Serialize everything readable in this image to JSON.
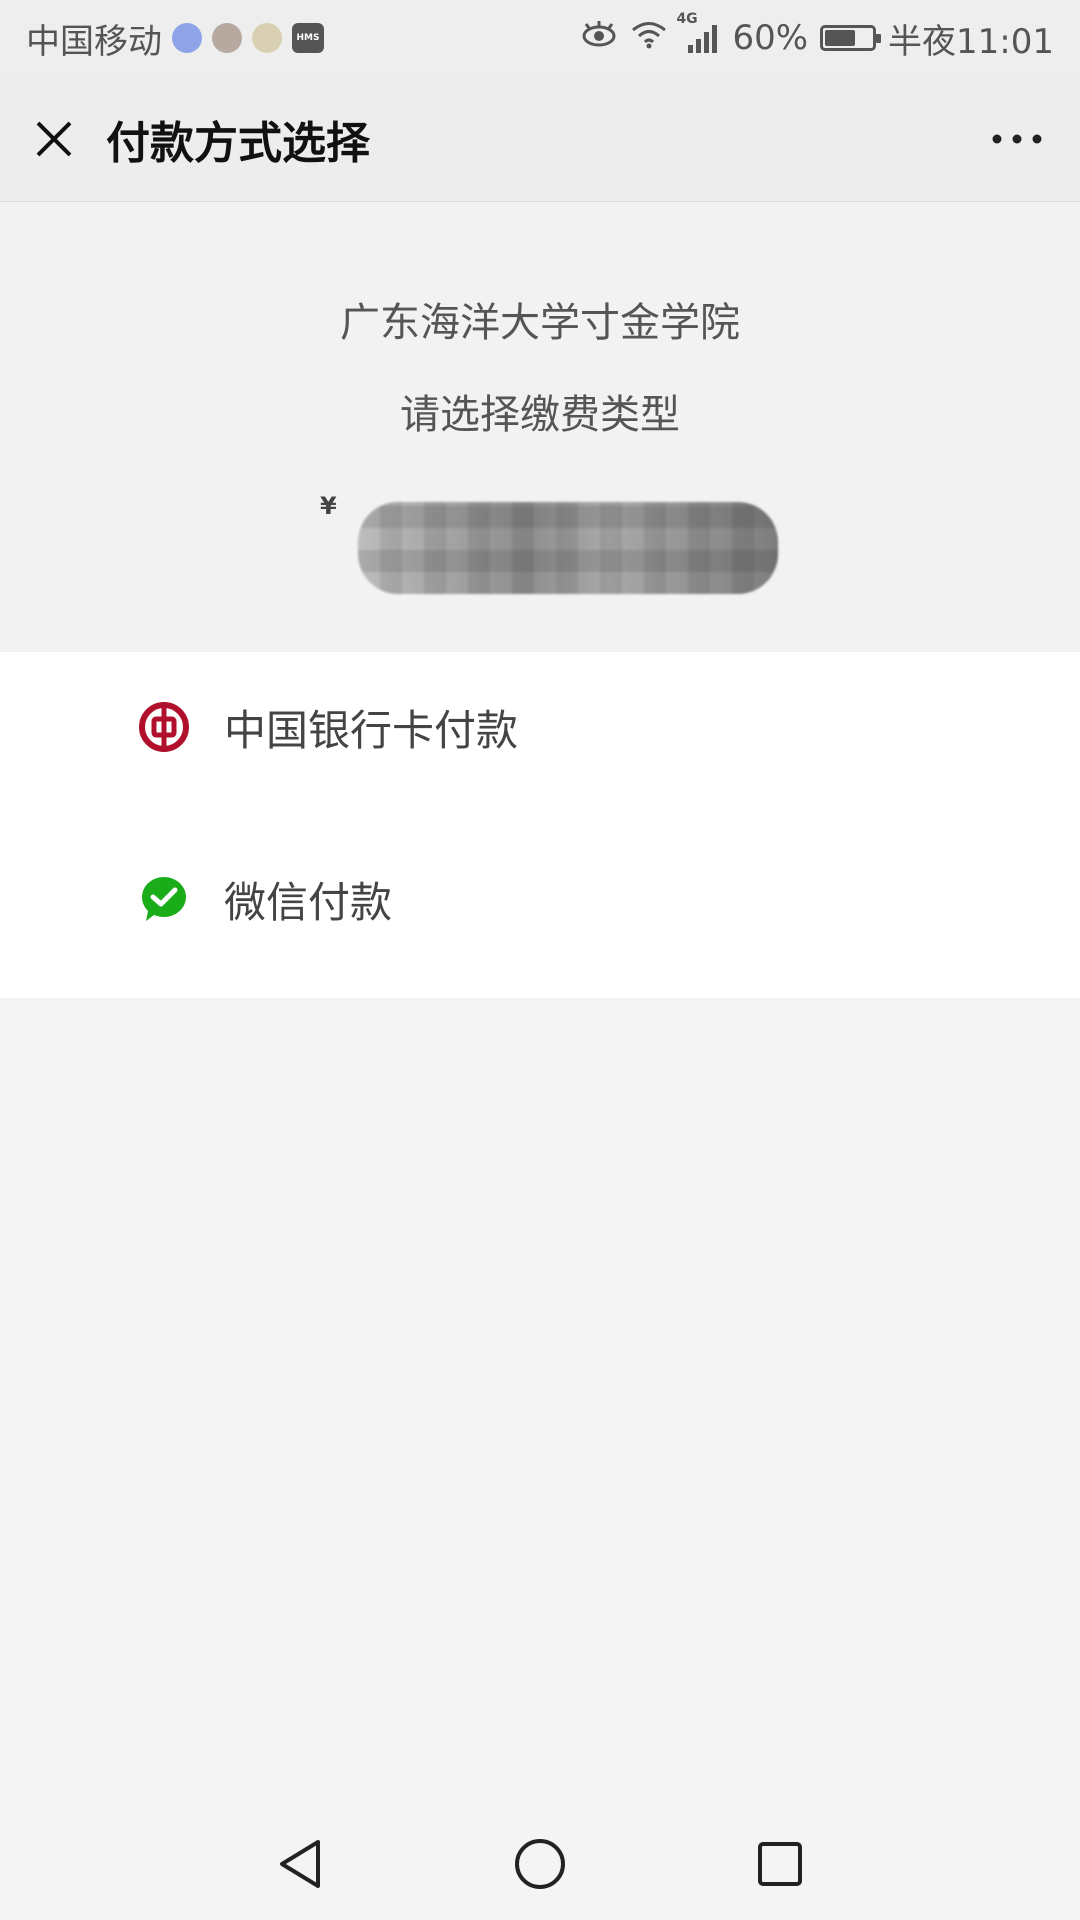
{
  "status_bar": {
    "carrier": "中国移动",
    "network": "4G",
    "battery": "60%",
    "time": "半夜11:01",
    "hms_label": "HMS"
  },
  "title_bar": {
    "title": "付款方式选择"
  },
  "header": {
    "school_name": "广东海洋大学寸金学院",
    "prompt": "请选择缴费类型",
    "currency_symbol": "¥"
  },
  "payment_options": [
    {
      "label": "中国银行卡付款",
      "icon": "bank-of-china-icon",
      "color": "#b0102b"
    },
    {
      "label": "微信付款",
      "icon": "wechat-pay-icon",
      "color": "#1aad19"
    }
  ],
  "nav": {
    "back": "back-icon",
    "home": "home-icon",
    "recents": "recents-icon"
  }
}
